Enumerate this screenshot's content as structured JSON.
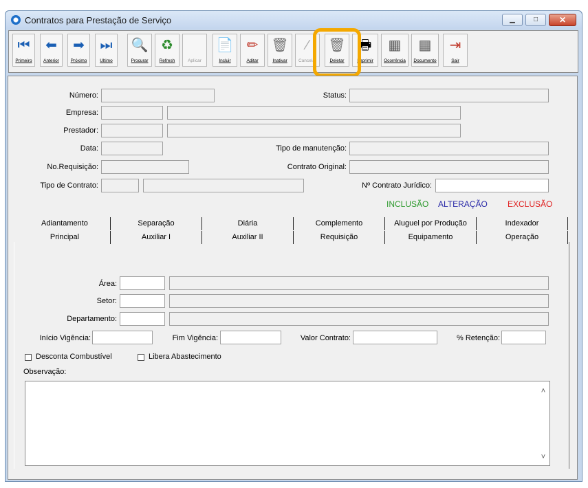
{
  "window": {
    "title": "Contratos para Prestação de Serviço"
  },
  "toolbar": {
    "buttons": [
      {
        "label": "Primeiro",
        "icon": "first-icon",
        "glyph": "⏮"
      },
      {
        "label": "Anterior",
        "icon": "previous-icon",
        "glyph": "⬅"
      },
      {
        "label": "Próximo",
        "icon": "next-icon",
        "glyph": "➡"
      },
      {
        "label": "Último",
        "icon": "last-icon",
        "glyph": "⏭"
      },
      {
        "label": "Procurar",
        "icon": "search-icon",
        "glyph": "🔍"
      },
      {
        "label": "Refresh",
        "icon": "refresh-icon",
        "glyph": "♻"
      },
      {
        "label": "Aplicar",
        "icon": "apply-icon",
        "glyph": " "
      },
      {
        "label": "Incluir",
        "icon": "include-icon",
        "glyph": "📄"
      },
      {
        "label": "Aditar",
        "icon": "eraser-icon",
        "glyph": "✏"
      },
      {
        "label": "Inativar",
        "icon": "inactivate-icon",
        "glyph": "🗑"
      },
      {
        "label": "Cancelar",
        "icon": "cancel-icon",
        "glyph": "⁄"
      },
      {
        "label": "Deletar",
        "icon": "delete-icon",
        "glyph": "🗑"
      },
      {
        "label": "Imprimir",
        "icon": "printer-icon",
        "glyph": "🖶"
      },
      {
        "label": "Ocorrência",
        "icon": "grid-icon",
        "glyph": "▦"
      },
      {
        "label": "Documento",
        "icon": "grid-icon",
        "glyph": "▦"
      },
      {
        "label": "Sair",
        "icon": "exit-icon",
        "glyph": "⇥"
      }
    ]
  },
  "form": {
    "numero_label": "Número:",
    "status_label": "Status:",
    "empresa_label": "Empresa:",
    "prestador_label": "Prestador:",
    "data_label": "Data:",
    "tipo_manutencao_label": "Tipo de manutenção:",
    "no_requisicao_label": "No.Requisição:",
    "contrato_original_label": "Contrato Original:",
    "tipo_contrato_label": "Tipo de Contrato:",
    "contrato_juridico_label": "Nº Contrato Jurídico:"
  },
  "status_legend": {
    "inclusao": "INCLUSÃO",
    "alteracao": "ALTERAÇÃO",
    "exclusao": "EXCLUSÃO",
    "inclusao_color": "#2e9a2e",
    "alteracao_color": "#2a2aa8",
    "exclusao_color": "#e02020"
  },
  "tabs_row1": [
    "Adiantamento",
    "Separação",
    "Diária",
    "Complemento",
    "Aluguel por Produção",
    "Indexador"
  ],
  "tabs_row2": [
    "Principal",
    "Auxiliar I",
    "Auxiliar II",
    "Requisição",
    "Equipamento",
    "Operação"
  ],
  "principal": {
    "area_label": "Área:",
    "setor_label": "Setor:",
    "departamento_label": "Departamento:",
    "inicio_vigencia_label": "Início Vigência:",
    "fim_vigencia_label": "Fim Vigência:",
    "valor_contrato_label": "Valor Contrato:",
    "retencao_label": "% Retenção:",
    "desconta_combustivel_label": "Desconta Combustível",
    "libera_abastecimento_label": "Libera Abastecimento",
    "observacao_label": "Observação:"
  }
}
